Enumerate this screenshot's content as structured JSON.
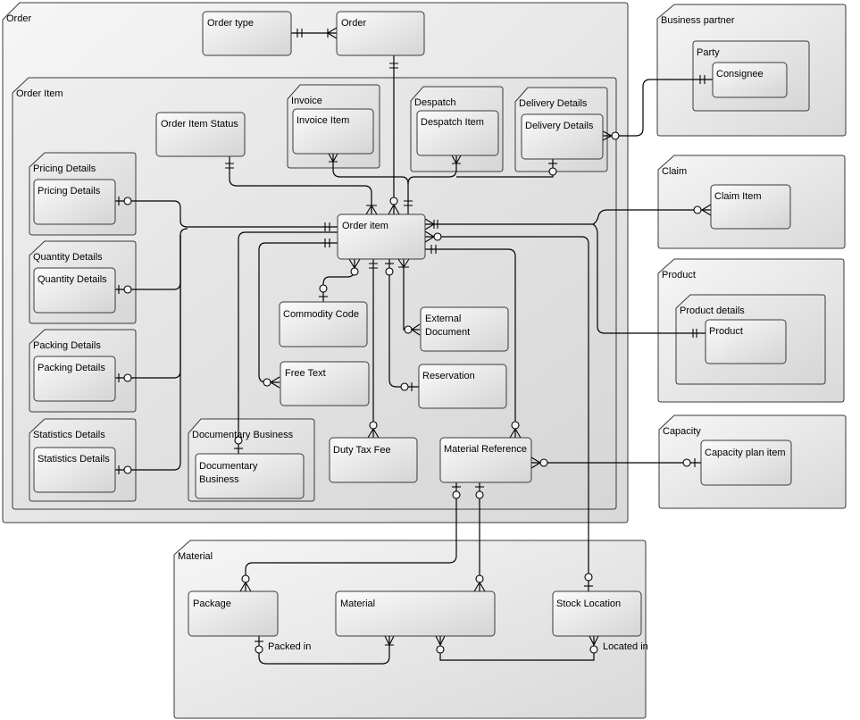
{
  "diagram": {
    "type": "entity-relationship",
    "packages": {
      "order": "Order",
      "order_item": "Order Item",
      "invoice": "Invoice",
      "despatch": "Despatch",
      "delivery_details": "Delivery Details",
      "pricing_details": "Pricing Details",
      "quantity_details": "Quantity Details",
      "packing_details": "Packing Details",
      "statistics_details": "Statistics Details",
      "documentary_business": "Documentary Business",
      "business_partner": "Business partner",
      "party": "Party",
      "claim": "Claim",
      "product": "Product",
      "product_details": "Product details",
      "capacity": "Capacity",
      "material": "Material"
    },
    "entities": {
      "order_type": "Order type",
      "order": "Order",
      "order_item_status": "Order Item Status",
      "invoice_item": "Invoice Item",
      "despatch_item": "Despatch Item",
      "delivery_details": "Delivery Details",
      "pricing_details": "Pricing Details",
      "quantity_details": "Quantity Details",
      "packing_details": "Packing Details",
      "statistics_details": "Statistics Details",
      "order_item": "Order item",
      "commodity_code": "Commodity Code",
      "external_document_1": "External",
      "external_document_2": "Document",
      "free_text": "Free Text",
      "reservation": "Reservation",
      "documentary_business_1": "Documentary",
      "documentary_business_2": "Business",
      "duty_tax_fee": "Duty Tax Fee",
      "material_reference": "Material Reference",
      "consignee": "Consignee",
      "claim_item": "Claim Item",
      "product": "Product",
      "capacity_plan_item": "Capacity plan item",
      "package": "Package",
      "material": "Material",
      "stock_location": "Stock Location"
    },
    "relationship_labels": {
      "packed_in": "Packed in",
      "located_in": "Located in"
    },
    "relationships": [
      {
        "from": "Order type",
        "to": "Order",
        "from_card": "one-and-only-one",
        "to_card": "one-or-many"
      },
      {
        "from": "Order",
        "to": "Order item",
        "from_card": "one-and-only-one",
        "to_card": "zero-or-many"
      },
      {
        "from": "Order Item Status",
        "to": "Order item",
        "from_card": "one-and-only-one",
        "to_card": "one-or-many"
      },
      {
        "from": "Invoice Item",
        "to": "Order item",
        "from_card": "one-or-many",
        "to_card": "one-and-only-one"
      },
      {
        "from": "Despatch Item",
        "to": "Order item",
        "from_card": "one-or-many",
        "to_card": "one-and-only-one"
      },
      {
        "from": "Delivery Details",
        "to": "Order item",
        "from_card": "zero-or-one",
        "to_card": "one-and-only-one"
      },
      {
        "from": "Delivery Details",
        "to": "Consignee",
        "from_card": "zero-or-many",
        "to_card": "one-and-only-one"
      },
      {
        "from": "Pricing Details",
        "to": "Order item",
        "from_card": "zero-or-one",
        "to_card": "one-and-only-one"
      },
      {
        "from": "Quantity Details",
        "to": "Order item",
        "from_card": "zero-or-one",
        "to_card": "one-and-only-one"
      },
      {
        "from": "Packing Details",
        "to": "Order item",
        "from_card": "zero-or-one",
        "to_card": "one-and-only-one"
      },
      {
        "from": "Statistics Details",
        "to": "Order item",
        "from_card": "zero-or-one",
        "to_card": "one-and-only-one"
      },
      {
        "from": "Order item",
        "to": "Commodity Code",
        "from_card": "zero-or-many",
        "to_card": "zero-or-one"
      },
      {
        "from": "Order item",
        "to": "Free Text",
        "from_card": "one-and-only-one",
        "to_card": "zero-or-many"
      },
      {
        "from": "Order item",
        "to": "External Document",
        "from_card": "one-or-many",
        "to_card": "zero-or-many"
      },
      {
        "from": "Order item",
        "to": "Reservation",
        "from_card": "zero-or-one",
        "to_card": "zero-or-one"
      },
      {
        "from": "Order item",
        "to": "Documentary Business",
        "from_card": "one-and-only-one",
        "to_card": "zero-or-one"
      },
      {
        "from": "Order item",
        "to": "Duty Tax Fee",
        "from_card": "one-and-only-one",
        "to_card": "zero-or-many"
      },
      {
        "from": "Order item",
        "to": "Material Reference",
        "from_card": "one-and-only-one",
        "to_card": "zero-or-many"
      },
      {
        "from": "Order item",
        "to": "Claim Item",
        "from_card": "one-or-many",
        "to_card": "zero-or-many"
      },
      {
        "from": "Order item",
        "to": "Product",
        "from_card": "one-or-many",
        "to_card": "one-and-only-one"
      },
      {
        "from": "Order item",
        "to": "Stock Location",
        "from_card": "zero-or-many",
        "to_card": "zero-or-one"
      },
      {
        "from": "Material Reference",
        "to": "Capacity plan item",
        "from_card": "zero-or-many",
        "to_card": "zero-or-one"
      },
      {
        "from": "Material Reference",
        "to": "Package",
        "from_card": "zero-or-one",
        "to_card": "zero-or-many"
      },
      {
        "from": "Material Reference",
        "to": "Material",
        "from_card": "zero-or-one",
        "to_card": "zero-or-many"
      },
      {
        "from": "Package",
        "to": "Material",
        "label": "Packed in",
        "from_card": "zero-or-one",
        "to_card": "one-or-many"
      },
      {
        "from": "Material",
        "to": "Stock Location",
        "label": "Located in",
        "from_card": "zero-or-many",
        "to_card": "zero-or-many"
      }
    ]
  }
}
